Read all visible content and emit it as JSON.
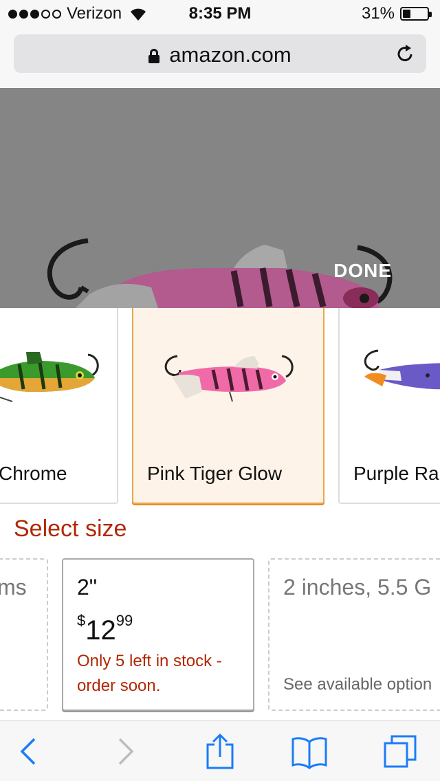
{
  "status_bar": {
    "carrier": "Verizon",
    "time": "8:35 PM",
    "battery": "31%",
    "battery_level": 0.31,
    "signal_bars_filled": 3,
    "signal_bars_total": 5
  },
  "address_bar": {
    "domain": "amazon.com",
    "secure": true
  },
  "image_viewer": {
    "done_label": "DONE"
  },
  "colors": {
    "items": [
      {
        "label": "Chrome",
        "selected": false
      },
      {
        "label": "Pink Tiger Glow",
        "selected": true
      },
      {
        "label": "Purple Ra",
        "selected": false
      }
    ]
  },
  "size_section": {
    "heading": "Select size",
    "options": [
      {
        "label": "ms",
        "available": false
      },
      {
        "label": "2\"",
        "price_currency": "$",
        "price_whole": "12",
        "price_fraction": "99",
        "stock_note": "Only 5 left in stock - order soon.",
        "selected": true
      },
      {
        "label": "2 inches, 5.5 G",
        "see_options": "See available option",
        "available": false
      }
    ]
  },
  "accent_colors": {
    "selection_orange": "#e48e1c",
    "price_red": "#b12704",
    "ios_blue": "#1a7cf9"
  },
  "toolbar": {
    "icons": [
      "back-icon",
      "forward-icon",
      "share-icon",
      "bookmarks-icon",
      "tabs-icon"
    ]
  }
}
